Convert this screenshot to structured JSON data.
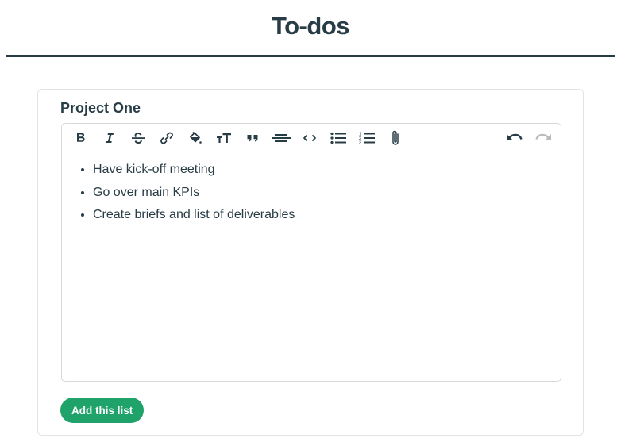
{
  "page": {
    "title": "To-dos"
  },
  "card": {
    "title": "Project One",
    "toolbar": {
      "left": [
        {
          "name": "bold-icon",
          "label": "Bold"
        },
        {
          "name": "italic-icon",
          "label": "Italic"
        },
        {
          "name": "strikethrough-icon",
          "label": "Strikethrough"
        },
        {
          "name": "link-icon",
          "label": "Link"
        },
        {
          "name": "highlight-color-icon",
          "label": "Highlight"
        },
        {
          "name": "text-size-icon",
          "label": "Heading"
        },
        {
          "name": "quote-icon",
          "label": "Quote"
        },
        {
          "name": "horizontal-rule-icon",
          "label": "Divider"
        },
        {
          "name": "code-icon",
          "label": "Code"
        },
        {
          "name": "bullet-list-icon",
          "label": "Bulleted list"
        },
        {
          "name": "numbered-list-icon",
          "label": "Numbered list"
        },
        {
          "name": "attachment-icon",
          "label": "Attach files"
        }
      ],
      "right": [
        {
          "name": "undo-icon",
          "label": "Undo"
        },
        {
          "name": "redo-icon",
          "label": "Redo"
        }
      ]
    },
    "items": [
      "Have kick-off meeting",
      "Go over main KPIs",
      "Create briefs and list of deliverables"
    ],
    "submit_label": "Add this list"
  },
  "colors": {
    "text": "#283c46",
    "accent": "#1fa36a",
    "disabled": "#b9bcbe"
  }
}
